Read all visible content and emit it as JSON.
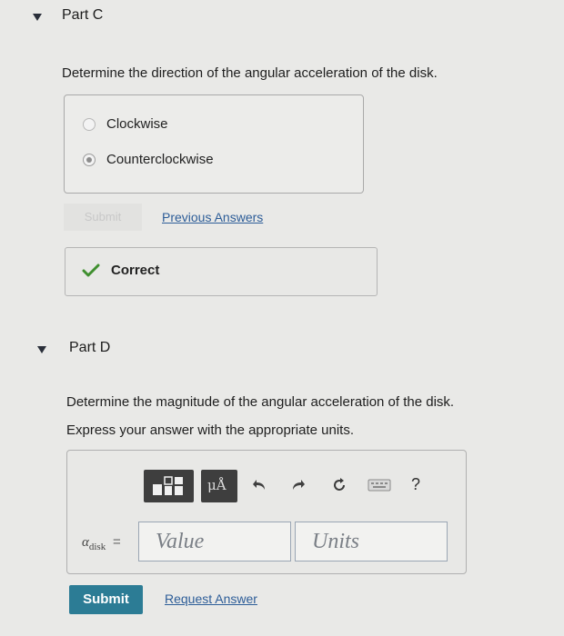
{
  "part_c": {
    "title": "Part C",
    "question": "Determine the direction of the angular acceleration of the disk.",
    "choices": [
      {
        "label": "Clockwise",
        "selected": false
      },
      {
        "label": "Counterclockwise",
        "selected": true
      }
    ],
    "submit_label": "Submit",
    "previous_answers_label": "Previous Answers",
    "feedback": "Correct"
  },
  "part_d": {
    "title": "Part D",
    "question": "Determine the magnitude of the angular acceleration of the disk.",
    "instruction": "Express your answer with the appropriate units.",
    "variable": "α",
    "subscript": "disk",
    "equals": "=",
    "value_placeholder": "Value",
    "units_placeholder": "Units",
    "toolbar": {
      "units_symbol": "μÅ",
      "help": "?"
    },
    "submit_label": "Submit",
    "request_answer_label": "Request Answer"
  },
  "colors": {
    "background": "#e9e9e7",
    "link": "#2d5d98",
    "submit": "#2c7c95",
    "check": "#3f8f2f"
  }
}
